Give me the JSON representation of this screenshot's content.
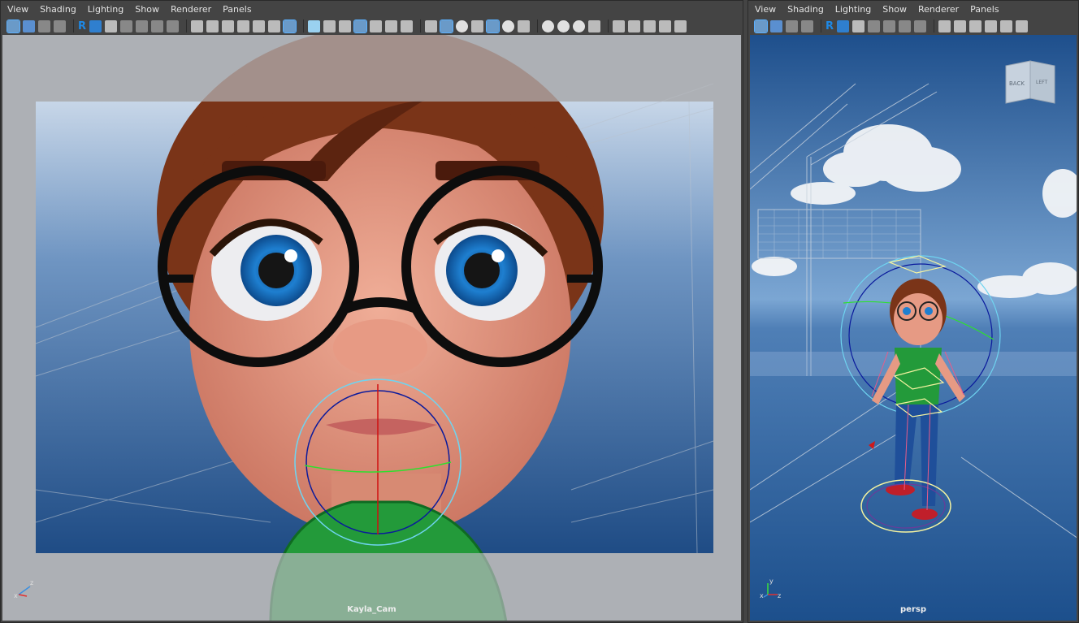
{
  "menu": [
    "View",
    "Shading",
    "Lighting",
    "Show",
    "Renderer",
    "Panels"
  ],
  "left_panel": {
    "camera_label": "Kayla_Cam",
    "axis_labels": {
      "x": "x",
      "y": "y",
      "z": "z"
    }
  },
  "right_panel": {
    "camera_label": "persp",
    "viewcube": {
      "face_back": "BACK",
      "face_left": "LEFT"
    },
    "axis_labels": {
      "x": "x",
      "y": "y",
      "z": "z"
    }
  },
  "colors": {
    "panel_bg": "#444444",
    "sky": "#2f5f9a",
    "skin": "#e69a84",
    "hair": "#7a3418",
    "iris": "#1e7fd0",
    "shirt": "#239a3a",
    "jeans": "#1f4f9a"
  },
  "icons": {
    "left_toolbar": [
      "select-camera-icon",
      "camera-attributes-icon",
      "bookmark-icon",
      "image-plane-icon",
      "2d-pan-icon",
      "grease-pencil-icon",
      "grid-icon",
      "film-gate-icon",
      "resolution-gate-icon",
      "gate-mask-icon",
      "field-chart-icon",
      "safe-action-icon",
      "safe-title-icon",
      "wireframe-icon",
      "smooth-shade-icon",
      "textured-icon",
      "lights-icon",
      "shadows-icon",
      "isolate-icon",
      "xray-icon"
    ],
    "right_toolbar": [
      "select-camera-icon",
      "render-icon",
      "snapshot-icon"
    ]
  }
}
